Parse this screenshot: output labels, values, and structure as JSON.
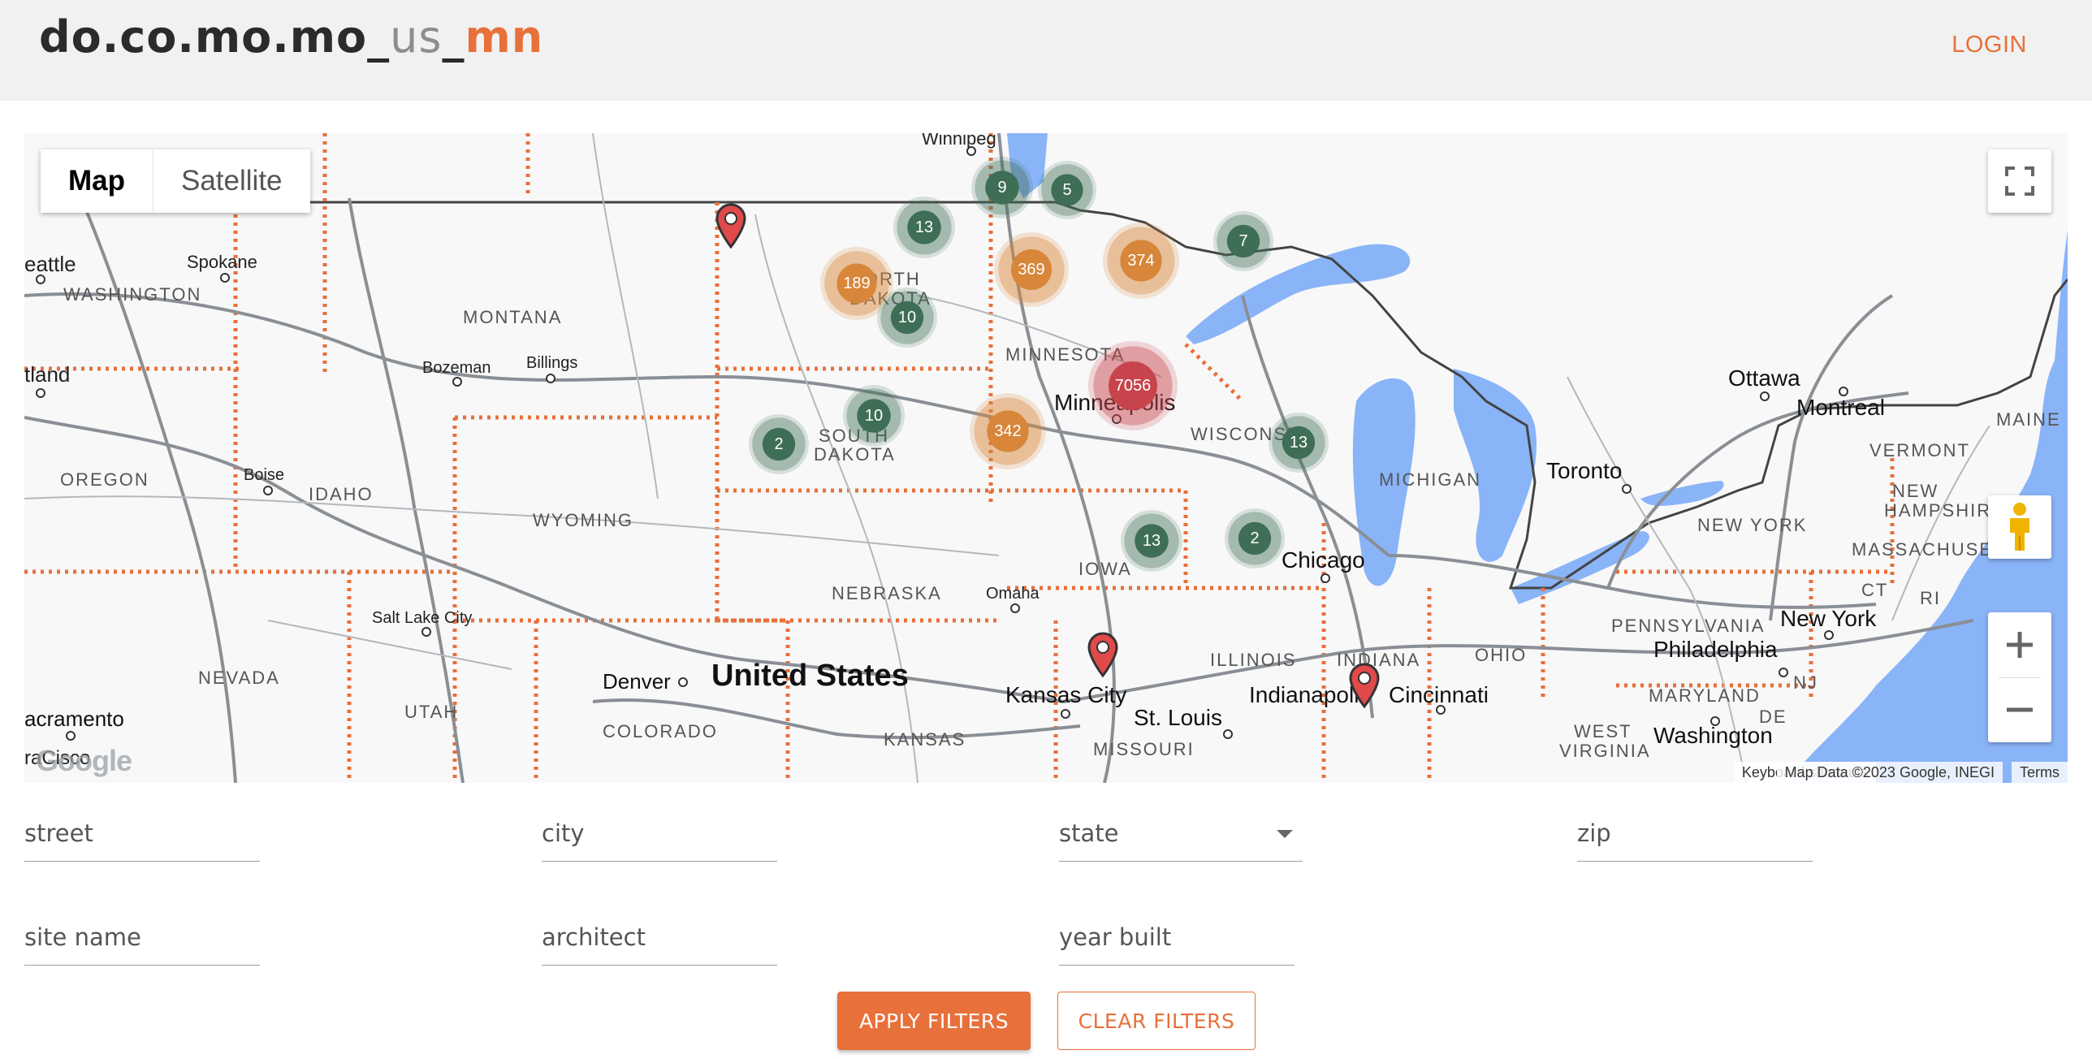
{
  "header": {
    "logo_main": "do.co.mo.mo_",
    "logo_us": "us",
    "logo_sep": "_",
    "logo_mn": "mn",
    "login": "LOGIN"
  },
  "map": {
    "map_type": {
      "map": "Map",
      "satellite": "Satellite",
      "selected": "Map"
    },
    "clusters": [
      {
        "count": "9",
        "color": "green"
      },
      {
        "count": "5",
        "color": "green"
      },
      {
        "count": "13",
        "color": "green"
      },
      {
        "count": "189",
        "color": "orange"
      },
      {
        "count": "369",
        "color": "orange"
      },
      {
        "count": "374",
        "color": "orange"
      },
      {
        "count": "7",
        "color": "green"
      },
      {
        "count": "10",
        "color": "green"
      },
      {
        "count": "7056",
        "color": "red"
      },
      {
        "count": "10",
        "color": "green"
      },
      {
        "count": "342",
        "color": "orange"
      },
      {
        "count": "2",
        "color": "green"
      },
      {
        "count": "13",
        "color": "green"
      },
      {
        "count": "13",
        "color": "green"
      },
      {
        "count": "2",
        "color": "green"
      }
    ],
    "labels": {
      "winnipeg": "Winnipeg",
      "seattle": "eattle",
      "spokane": "Spokane",
      "washington": "WASHINGTON",
      "montana": "MONTANA",
      "north_dakota": "NORTH\nDAKOTA",
      "minnesota": "MINNESOTA",
      "minneapolis": "Minneapolis",
      "portland": "tland",
      "bozeman": "Bozeman",
      "billings": "Billings",
      "south_dakota_1": "SOUTH",
      "south_dakota_2": "DAKOTA",
      "wisconsin": "WISCONSIN",
      "michigan": "MICHIGAN",
      "oregon": "OREGON",
      "boise": "Boise",
      "idaho": "IDAHO",
      "wyoming": "WYOMING",
      "iowa": "IOWA",
      "chicago": "Chicago",
      "nebraska": "NEBRASKA",
      "omaha": "Omaha",
      "salt_lake_city": "Salt Lake City",
      "nevada": "NEVADA",
      "utah": "UTAH",
      "denver": "Denver",
      "united_states": "United States",
      "colorado": "COLORADO",
      "kansas_city": "Kansas City",
      "kansas": "KANSAS",
      "st_louis": "St. Louis",
      "missouri": "MISSOURI",
      "illinois": "ILLINOIS",
      "indiana": "INDIANA",
      "indianapolis": "Indianapoli",
      "cincinnati": "Cincinnati",
      "ohio": "OHIO",
      "sacramento": "acramento",
      "ottawa": "Ottawa",
      "montreal": "Montreal",
      "maine": "MAINE",
      "vermont": "VERMONT",
      "toronto": "Toronto",
      "new_hampshire_1": "NEW",
      "new_hampshire_2": "HAMPSHIRE",
      "new_york_state": "NEW YORK",
      "massachusetts": "MASSACHUSETT",
      "ct": "CT",
      "ri": "RI",
      "pennsylvania": "PENNSYLVANIA",
      "new_york_city": "New York",
      "philadelphia": "Philadelphia",
      "nj": "NJ",
      "maryland": "MARYLAND",
      "de": "DE",
      "west_virginia_1": "WEST",
      "west_virginia_2": "VIRGINIA",
      "washington_dc": "Washington",
      "san_francisco": "raCisco"
    },
    "google_logo": "Google",
    "keyboard_shortcuts": "Keyboard shortcuts",
    "map_data": "Map Data ©2023 Google, INEGI",
    "terms": "Terms"
  },
  "filters": {
    "street_placeholder": "street",
    "city_placeholder": "city",
    "state_placeholder": "state",
    "zip_placeholder": "zip",
    "site_name_placeholder": "site name",
    "architect_placeholder": "architect",
    "year_built_placeholder": "year built",
    "apply": "APPLY FILTERS",
    "clear": "CLEAR FILTERS"
  },
  "colors": {
    "accent": "#e8703a",
    "cluster_green": "#3e6e56",
    "cluster_orange": "#d7863a",
    "cluster_red": "#c7444c",
    "water": "#8ab4f8"
  }
}
